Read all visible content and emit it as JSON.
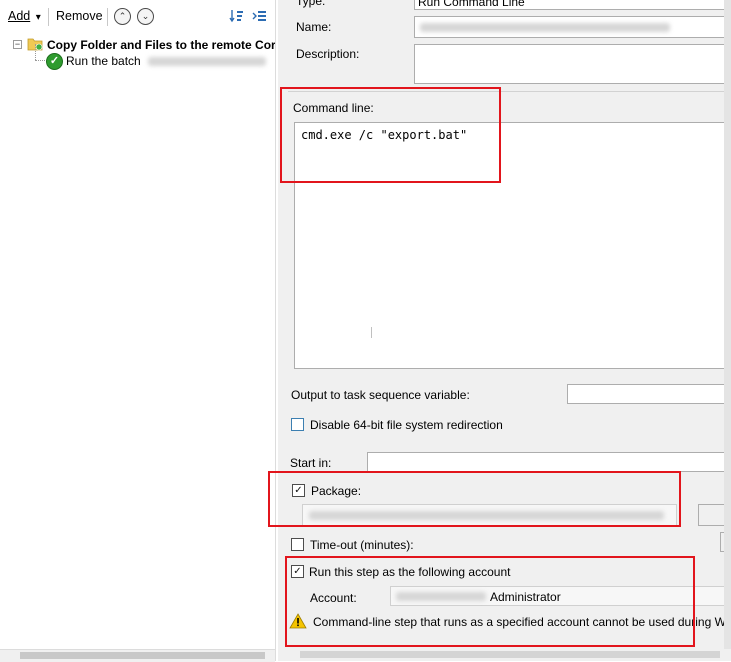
{
  "toolbar": {
    "add_label": "Add",
    "add_arrow": "▾",
    "remove_label": "Remove",
    "move_up_glyph": "⌃",
    "move_down_glyph": "⌄"
  },
  "tree": {
    "group_label": "Copy Folder and Files to the remote Cor",
    "step_label": "Run the batch",
    "expander_glyph": "−"
  },
  "properties": {
    "type_label": "Type:",
    "type_value": "Run Command Line",
    "name_label": "Name:",
    "description_label": "Description:",
    "command_line_label": "Command line:",
    "command_line_value": "cmd.exe /c \"export.bat\"",
    "output_var_label": "Output to task sequence variable:",
    "disable_redirection_label": "Disable 64-bit file system redirection",
    "start_in_label": "Start in:",
    "package_label": "Package:",
    "timeout_label": "Time-out (minutes):",
    "run_as_label": "Run this step as the following account",
    "account_label": "Account:",
    "account_value": "Administrator",
    "warning_text": "Command-line step that runs as a specified account cannot be used during Windows P"
  },
  "icons": {
    "check_glyph": "✓",
    "warning_glyph": "!"
  },
  "colors": {
    "annotation_red": "#e2151c",
    "success_green": "#2e9b2e",
    "warning_yellow": "#f5c400",
    "pane_background": "#f0f0f0"
  }
}
